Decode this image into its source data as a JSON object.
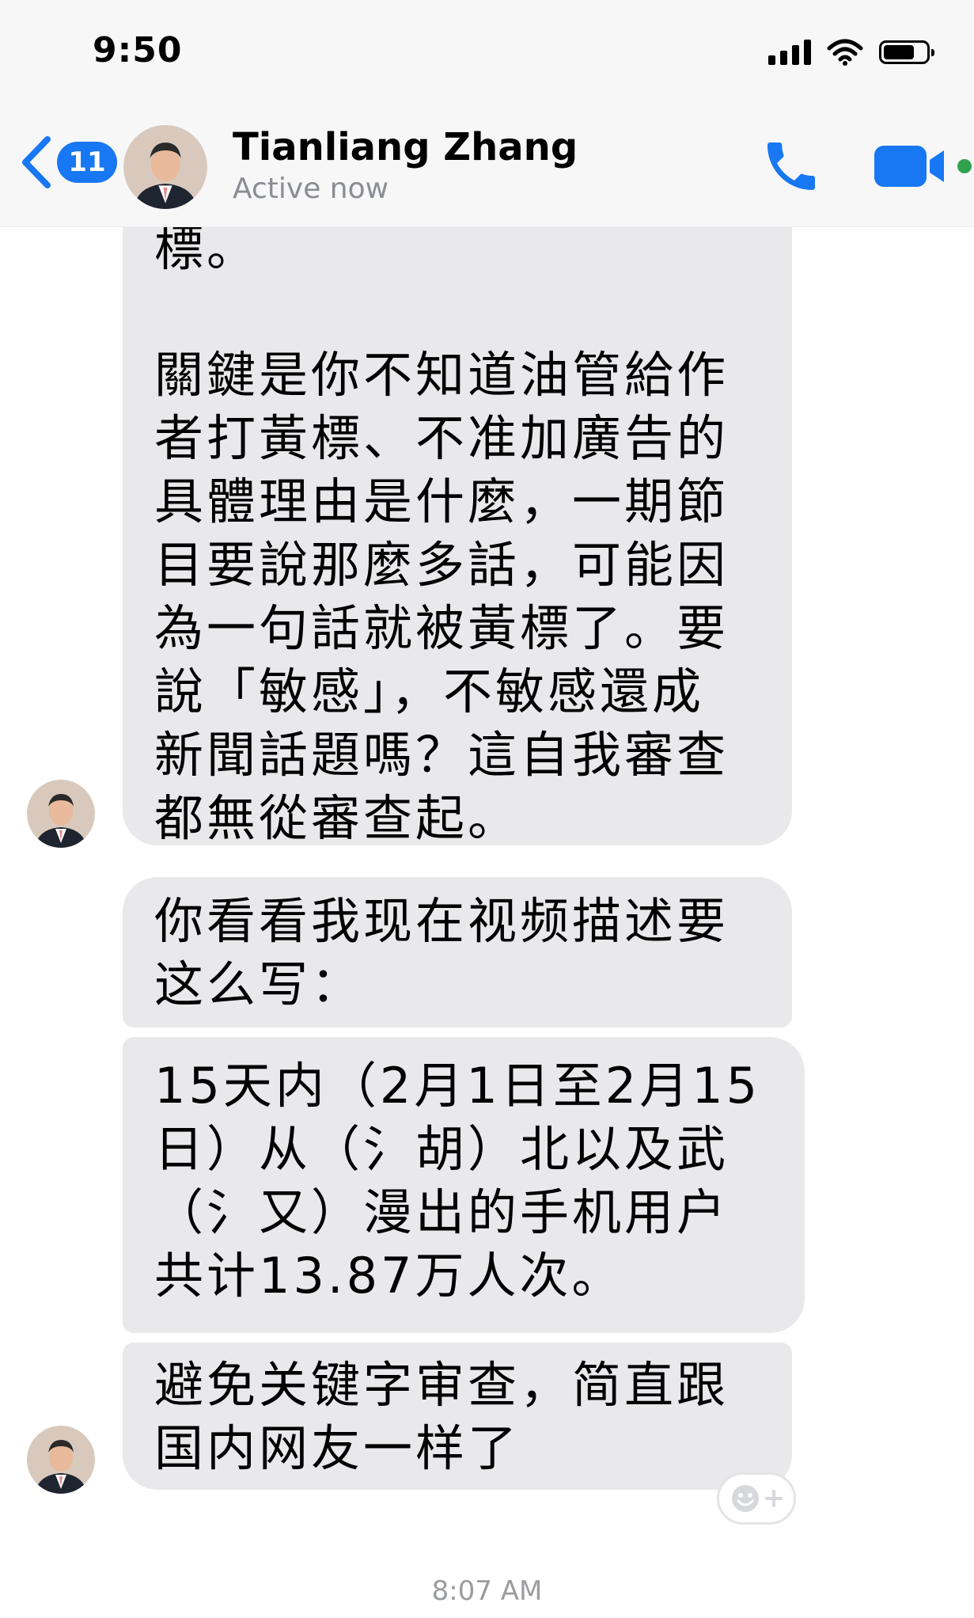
{
  "status_bar": {
    "time": "9:50"
  },
  "header": {
    "back_badge_count": "11",
    "contact_name": "Tianliang Zhang",
    "active_status": "Active now",
    "accent_color": "#1877f2",
    "online_indicator_color": "#31a24c",
    "icons": [
      "back-chevron-icon",
      "phone-icon",
      "video-camera-icon",
      "online-dot-icon"
    ]
  },
  "messages": [
    {
      "text": "標。\n\n關鍵是你不知道油管給作\n者打黃標、不准加廣告的\n具體理由是什麼，一期節\n目要說那麼多話，可能因\n為一句話就被黃標了。要\n說「敏感」，不敏感還成\n新聞話題嗎？這自我審查\n都無從審查起。"
    },
    {
      "text": "你看看我现在视频描述要\n这么写："
    },
    {
      "text": "15天内（2月1日至2月15\n日）从（氵胡）北以及武\n（氵又）漫出的手机用户\n共计13.87万人次。"
    },
    {
      "text": "避免关键字审查，简直跟\n国内网友一样了"
    }
  ],
  "reaction_button": {
    "icon": "emoji-add-reaction-icon"
  },
  "timestamp": "8:07 AM",
  "bubble_color": "#e9e9eb"
}
